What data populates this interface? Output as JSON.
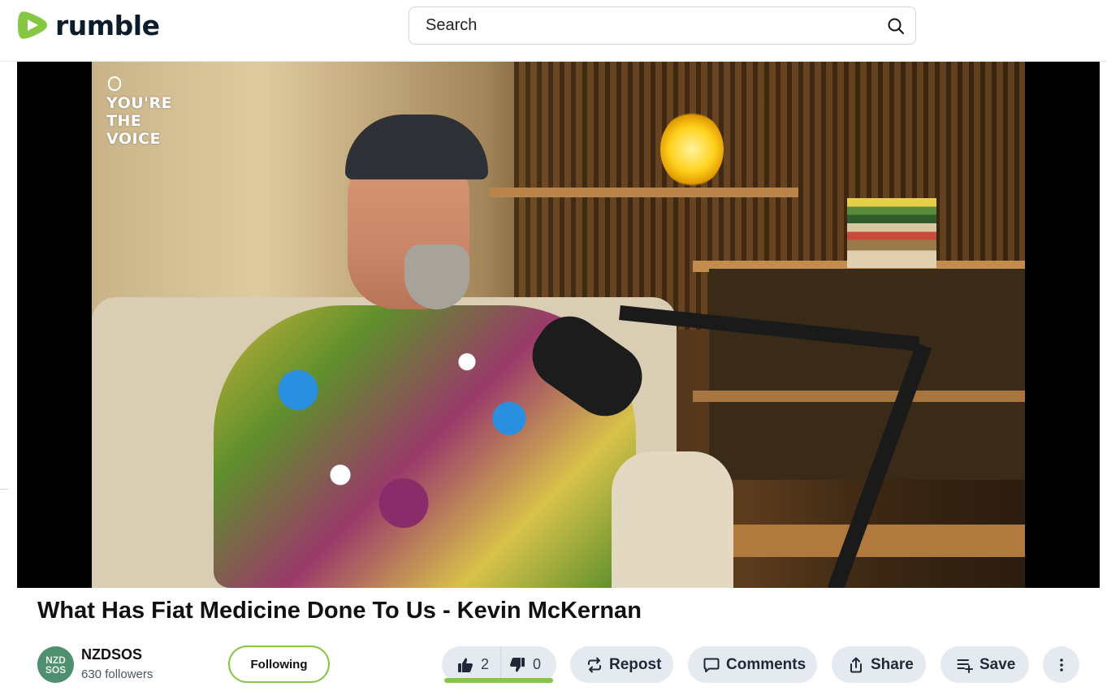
{
  "header": {
    "logo_text": "rumble",
    "search_placeholder": "Search"
  },
  "player": {
    "watermark": "YOU'RE\nTHE\nVOICE"
  },
  "video": {
    "title": "What Has Fiat Medicine Done To Us - Kevin McKernan"
  },
  "channel": {
    "avatar_line1": "NZD",
    "avatar_line2": "SOS",
    "name": "NZDSOS",
    "followers": "630 followers",
    "follow_label": "Following"
  },
  "actions": {
    "likes": "2",
    "dislikes": "0",
    "repost": "Repost",
    "comments": "Comments",
    "share": "Share",
    "save": "Save"
  },
  "colors": {
    "brand_green": "#85c742",
    "pill_bg": "#e5eaf0"
  }
}
